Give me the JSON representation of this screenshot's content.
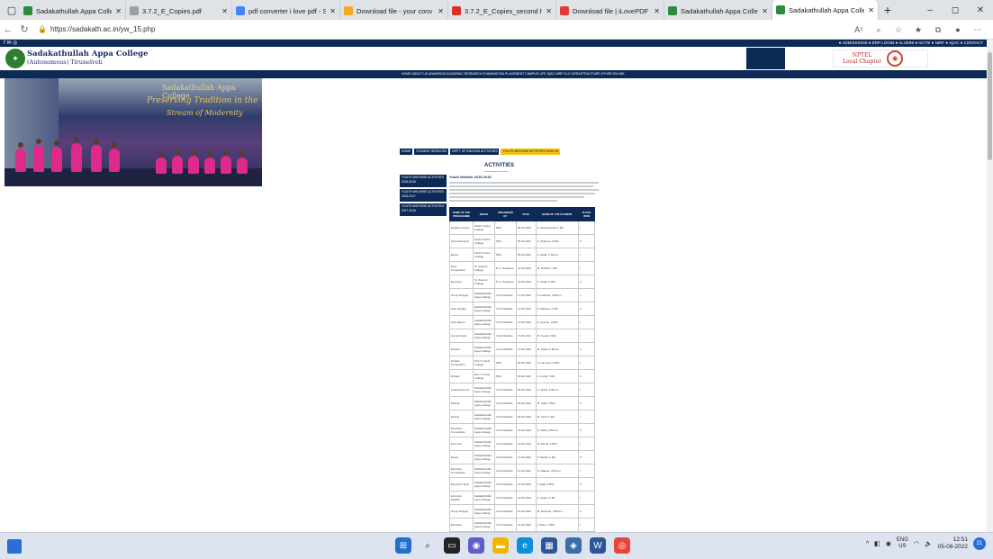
{
  "browser": {
    "tabs": [
      {
        "title": "Sadakathullah Appa Colle",
        "fav": "#2e8b3d"
      },
      {
        "title": "3.7.2_E_Copies.pdf",
        "fav": "#9aa0a6"
      },
      {
        "title": "pdf converter i love pdf - S",
        "fav": "#4285f4"
      },
      {
        "title": "Download file - your conv",
        "fav": "#f9a825"
      },
      {
        "title": "3.7.2_E_Copies_second ha",
        "fav": "#d93025"
      },
      {
        "title": "Download file | iLovePDF",
        "fav": "#e53935"
      },
      {
        "title": "Sadakathullah Appa Colle",
        "fav": "#2e8b3d"
      },
      {
        "title": "Sadakathullah Appa Colle",
        "fav": "#2e8b3d"
      }
    ],
    "url": "https://sadakath.ac.in/yw_15.php",
    "win_controls": [
      "–",
      "◻",
      "✕"
    ],
    "new_tab": "+",
    "addr_icons": [
      "A⁵",
      "⌕",
      "☆",
      "★",
      "⧉",
      "●",
      "⋯"
    ]
  },
  "site": {
    "college_name": "Sadakathullah Appa College",
    "college_sub": "(Autonomous) Tirunelveli",
    "nptel_line1": "NPTEL",
    "nptel_line2": "Local Chapter",
    "topbar_right": "● ADMISSIONS  ● ERP LOGIN  ● ALUMNI  ● AICTE  ● NIRF  ● IQAC  ● CONTACT",
    "menu": "HOME  ABOUT US  ADMISSION  ACADEMIC  RESEARCH  EXAMINATION  PLACEMENT  CAMPUS LIFE  IQAC  NIRF  DLC  INFRASTRUCTURE  OTHER ONLINE",
    "banner_title1": "Sadakathullah Appa College",
    "banner_title2": "Preserving Tradition in the",
    "banner_title3": "Stream of Modernity",
    "breadcrumb": [
      "HOME",
      "STUDENT SERVICES",
      "DEPT. OF ENGLISH ACTIVITIES",
      "YOUTH WELFARE ACTIVITIES 2015-16"
    ],
    "section_title": "ACTIVITIES",
    "side_menu": [
      "YOUTH WELFARE ACTIVITIES 2015-2016",
      "YOUTH WELFARE ACTIVITIES 2016-2017",
      "YOUTH WELFARE ACTIVITIES 2017-2018"
    ],
    "content_heading": "Youth Welfare 2015-2016",
    "table_headers": [
      "NAME OF THE PROGRAMME",
      "VENUE",
      "ORGANISED BY",
      "DATE",
      "NAME OF THE STUDENT",
      "PLACE WON"
    ],
    "rows": [
      [
        "English Literary",
        "Sarah Tucker College",
        "NSS",
        "05.03.2016",
        "A. Mohamed Ali, II BA",
        "I"
      ],
      [
        "Tamil Elocution",
        "Sarah Tucker College",
        "NSS",
        "05.03.2016",
        "S. Ahamed, II BSc",
        "II"
      ],
      [
        "Essay",
        "Sarah Tucker College",
        "NSS",
        "05.03.2016",
        "S. Abdul, II BCom",
        "I"
      ],
      [
        "Quiz Competition",
        "St. Xaviers College",
        "N.C. Thanjavur",
        "12.02.2016",
        "M. Ibrahim, II BA",
        "I"
      ],
      [
        "Elocution",
        "St. Xaviers College",
        "N.C. Thanjavur",
        "12.02.2016",
        "K. Abdul, II BSc",
        "II"
      ],
      [
        "Group Singing",
        "Sadakathullah Appa College",
        "Youth Welfare",
        "17.02.2016",
        "S. Fathima, II BCom",
        "I"
      ],
      [
        "Solo Singing",
        "Sadakathullah Appa College",
        "Youth Welfare",
        "17.02.2016",
        "S. Raheem, II BA",
        "II"
      ],
      [
        "Solo Dance",
        "Sadakathullah Appa College",
        "Youth Welfare",
        "17.02.2016",
        "S. Ayesha, II BSc",
        "I"
      ],
      [
        "Group Dance",
        "Sadakathullah Appa College",
        "Youth Welfare",
        "17.02.2016",
        "B. Yousuf, II BA",
        "I"
      ],
      [
        "Debate",
        "Sadakathullah Appa College",
        "Youth Welfare",
        "17.02.2016",
        "M. Kader, II BCom",
        "II"
      ],
      [
        "Debate Competition",
        "M.D.T. Hindu College",
        "NSS",
        "02.02.2016",
        "S. Hameed, II BSc",
        "I"
      ],
      [
        "Debate",
        "M.D.T. Hindu College",
        "NSS",
        "02.02.2016",
        "A. Ismail, II BA",
        "II"
      ],
      [
        "Cultural Events",
        "Sadakathullah Appa College",
        "Youth Welfare",
        "05.02.2016",
        "A. Nisha, II BCom",
        "I"
      ],
      [
        "Writing",
        "Sadakathullah Appa College",
        "Youth Welfare",
        "05.02.2016",
        "M. Jafar, II BSc",
        "II"
      ],
      [
        "Drama",
        "Sadakathullah Appa College",
        "Youth Welfare",
        "05.02.2016",
        "M. Syed, II BA",
        "I"
      ],
      [
        "Elocution Competition",
        "Sadakathullah Appa College",
        "Youth Welfare",
        "14.02.2016",
        "S. Rafiq, II BCom",
        "II"
      ],
      [
        "Fine Arts",
        "Sadakathullah Appa College",
        "Youth Welfare",
        "14.02.2016",
        "N. Salma, II BSc",
        "I"
      ],
      [
        "Essay",
        "Sadakathullah Appa College",
        "Youth Welfare",
        "14.02.2016",
        "K. Basha, II BA",
        "II"
      ],
      [
        "Elocution Competition",
        "Sadakathullah Appa College",
        "Youth Welfare",
        "21.02.2016",
        "S. Majeed, II BCom",
        "I"
      ],
      [
        "Elocution Tamil",
        "Sadakathullah Appa College",
        "Youth Welfare",
        "21.02.2016",
        "T. Raja, II BSc",
        "II"
      ],
      [
        "Elocution English",
        "Sadakathullah Appa College",
        "Youth Welfare",
        "21.02.2016",
        "A. Aslam, II BA",
        "I"
      ],
      [
        "Group Singing",
        "Sadakathullah Appa College",
        "Youth Welfare",
        "21.02.2016",
        "M. Rahman, II BCom",
        "II"
      ],
      [
        "Elocution",
        "Sadakathullah Appa College",
        "Youth Welfare",
        "21.02.2016",
        "F. Banu, II BSc",
        "I"
      ],
      [
        "Quiz",
        "Sadakathullah Appa College",
        "Youth Welfare",
        "21.02.2016",
        "H. Ali, II BA",
        "II"
      ]
    ]
  },
  "taskbar": {
    "lang_top": "ENG",
    "lang_bottom": "US",
    "time": "12:51",
    "date": "05-08-2022",
    "notif_count": "21"
  }
}
